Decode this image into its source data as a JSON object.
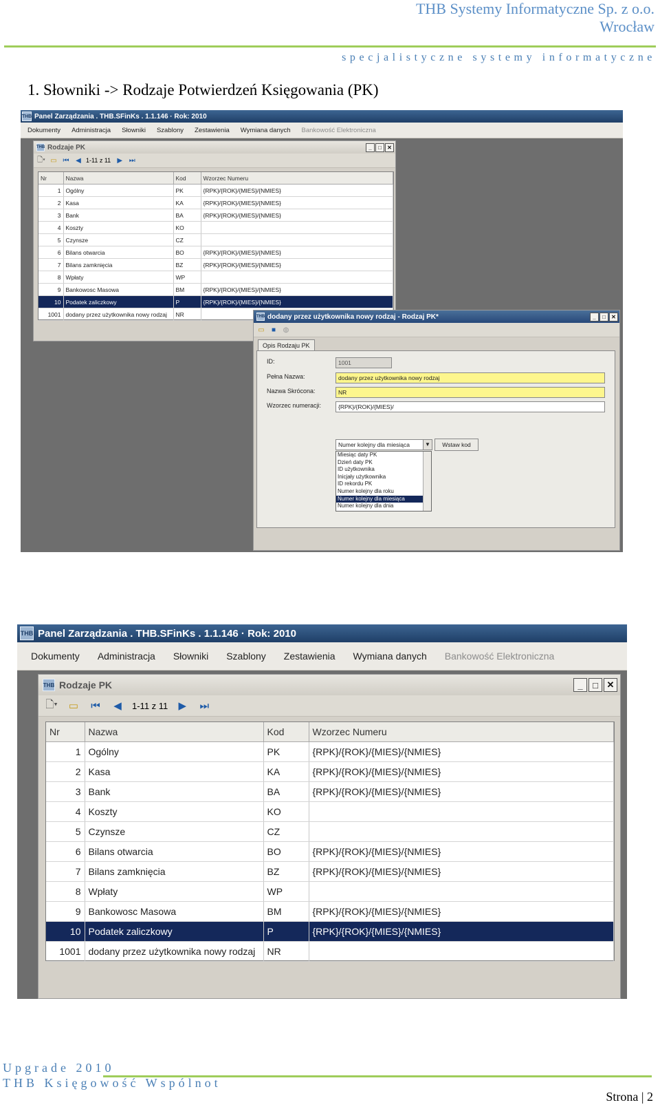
{
  "header": {
    "company": "THB Systemy Informatyczne Sp. z o.o.",
    "city": "Wrocław",
    "tagline": "specjalistyczne systemy informatyczne"
  },
  "section_title": "1. Słowniki -> Rodzaje Potwierdzeń Księgowania (PK)",
  "app": {
    "title": "Panel Zarządzania . THB.SFinKs . 1.1.146 · Rok: 2010",
    "logo_text": "THB",
    "menu": [
      "Dokumenty",
      "Administracja",
      "Słowniki",
      "Szablony",
      "Zestawienia",
      "Wymiana danych",
      "Bankowość Elektroniczna"
    ]
  },
  "pk_window": {
    "title": "Rodzaje PK",
    "pager": "1-11 z 11",
    "columns": [
      "Nr",
      "Nazwa",
      "Kod",
      "Wzorzec Numeru"
    ],
    "rows": [
      {
        "nr": "1",
        "nazwa": "Ogólny",
        "kod": "PK",
        "wzorzec": "{RPK}/{ROK}/{MIES}/{NMIES}"
      },
      {
        "nr": "2",
        "nazwa": "Kasa",
        "kod": "KA",
        "wzorzec": "{RPK}/{ROK}/{MIES}/{NMIES}"
      },
      {
        "nr": "3",
        "nazwa": "Bank",
        "kod": "BA",
        "wzorzec": "{RPK}/{ROK}/{MIES}/{NMIES}"
      },
      {
        "nr": "4",
        "nazwa": "Koszty",
        "kod": "KO",
        "wzorzec": ""
      },
      {
        "nr": "5",
        "nazwa": "Czynsze",
        "kod": "CZ",
        "wzorzec": ""
      },
      {
        "nr": "6",
        "nazwa": "Bilans otwarcia",
        "kod": "BO",
        "wzorzec": "{RPK}/{ROK}/{MIES}/{NMIES}"
      },
      {
        "nr": "7",
        "nazwa": "Bilans zamknięcia",
        "kod": "BZ",
        "wzorzec": "{RPK}/{ROK}/{MIES}/{NMIES}"
      },
      {
        "nr": "8",
        "nazwa": "Wpłaty",
        "kod": "WP",
        "wzorzec": ""
      },
      {
        "nr": "9",
        "nazwa": "Bankowosc Masowa",
        "kod": "BM",
        "wzorzec": "{RPK}/{ROK}/{MIES}/{NMIES}"
      },
      {
        "nr": "10",
        "nazwa": "Podatek zaliczkowy",
        "kod": "P",
        "wzorzec": "{RPK}/{ROK}/{MIES}/{NMIES}",
        "selected": true
      },
      {
        "nr": "1001",
        "nazwa": "dodany przez użytkownika nowy rodzaj",
        "kod": "NR",
        "wzorzec": ""
      }
    ]
  },
  "dialog": {
    "title": "dodany przez użytkownika nowy rodzaj - Rodzaj PK*",
    "tab": "Opis Rodzaju PK",
    "id_label": "ID:",
    "id_value": "1001",
    "full_name_label": "Pełna Nazwa:",
    "full_name_value": "dodany przez użytkownika nowy rodzaj",
    "short_name_label": "Nazwa Skrócona:",
    "short_name_value": "NR",
    "pattern_label": "Wzorzec numeracji:",
    "pattern_value": "{RPK}/{ROK}/{MIES}/",
    "combo_selected": "Numer kolejny dla miesiąca",
    "insert_button": "Wstaw kod",
    "options": [
      "Miesiąc daty PK",
      "Dzień daty PK",
      "ID użytkownika",
      "Inicjały użytkownika",
      "ID rekordu PK",
      "Numer kolejny dla roku",
      "Numer kolejny dla miesiąca",
      "Numer kolejny dla dnia"
    ],
    "selected_option_index": 6
  },
  "footer": {
    "line1": "Upgrade 2010",
    "line2": "THB Księgowość Wspólnot",
    "page": "Strona | 2"
  },
  "colors": {
    "header_blue": "#5b8fc7",
    "accent_green": "#9fcd5a",
    "selection": "#14285a",
    "field_yellow": "#fdf68d"
  }
}
